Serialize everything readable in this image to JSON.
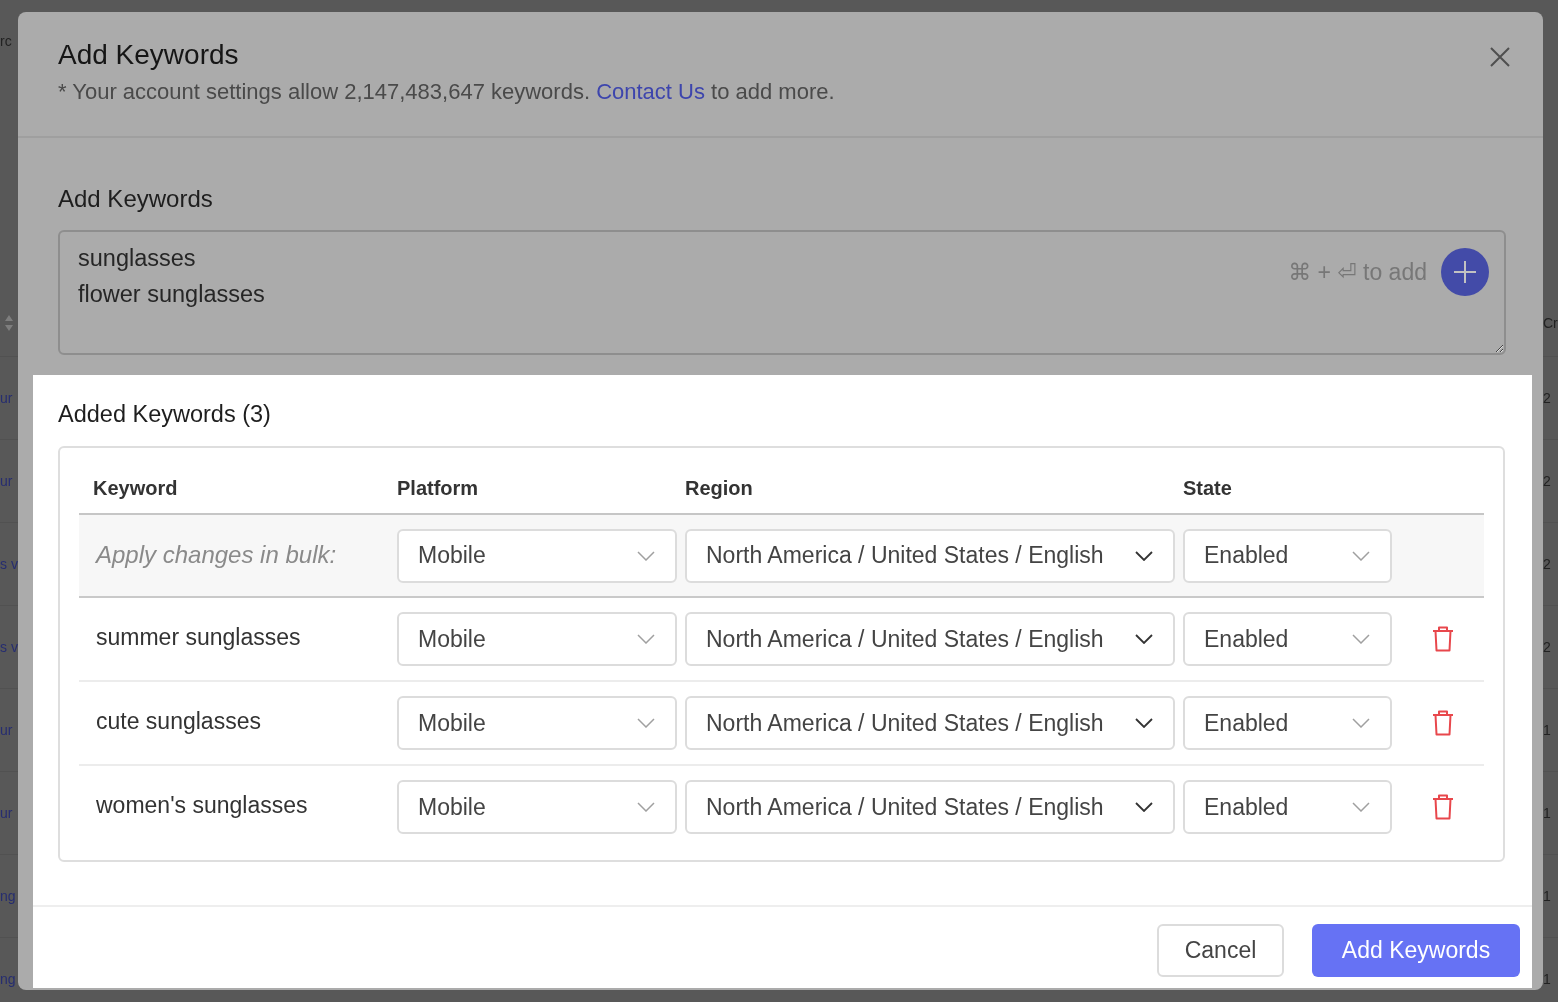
{
  "background_page": {
    "left_header_fragment": "rc",
    "left_fragments": [
      "ur",
      "ur",
      "s v",
      "s v",
      "ur",
      "ur",
      "ng",
      "ng"
    ],
    "right_header_fragment": "Cr",
    "right_fragments": [
      "2",
      "2",
      "2",
      "2",
      "1",
      "1",
      "1",
      "1"
    ]
  },
  "dialog": {
    "title": "Add Keywords",
    "note": {
      "text_before": "* Your account settings allow 2,147,483,647 keywords.",
      "link": "Contact Us",
      "text_after": "to add more."
    }
  },
  "add_keywords": {
    "label": "Add Keywords",
    "textarea": {
      "value": "sunglasses\nflower sunglasses"
    },
    "shortcut_hint": "⌘ + ⏎ to add"
  },
  "added_keywords": {
    "title": "Added Keywords (3)",
    "table": {
      "columns": [
        "Keyword",
        "Platform",
        "Region",
        "State"
      ],
      "bulk_row": {
        "label": "Apply changes in bulk:",
        "platform": "Mobile",
        "region": "North America / United States / English",
        "state": "Enabled"
      },
      "rows": [
        {
          "keyword": "summer sunglasses",
          "platform": "Mobile",
          "region": "North America / United States / English",
          "state": "Enabled"
        },
        {
          "keyword": "cute sunglasses",
          "platform": "Mobile",
          "region": "North America / United States / English",
          "state": "Enabled"
        },
        {
          "keyword": "women's sunglasses",
          "platform": "Mobile",
          "region": "North America / United States / English",
          "state": "Enabled"
        }
      ]
    }
  },
  "footer": {
    "buttons": [
      {
        "label": "Cancel",
        "kind": "secondary"
      },
      {
        "label": "Add Keywords",
        "kind": "primary"
      }
    ]
  }
}
